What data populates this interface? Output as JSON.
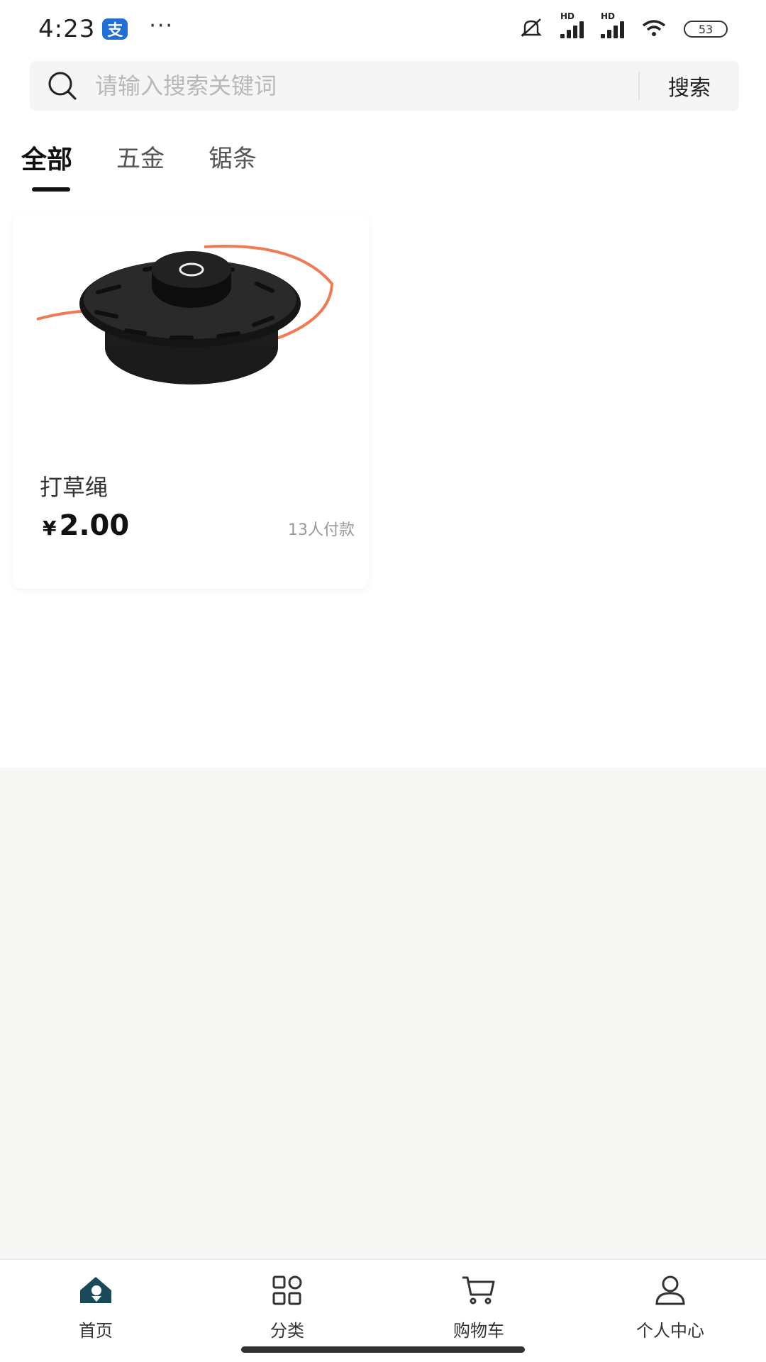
{
  "status_bar": {
    "time": "4:23",
    "alipay_badge": "支",
    "more": "···",
    "battery": "53",
    "signal_label": "HD"
  },
  "search": {
    "placeholder": "请输入搜索关键词",
    "button_label": "搜索"
  },
  "tabs": [
    {
      "label": "全部",
      "active": true
    },
    {
      "label": "五金",
      "active": false
    },
    {
      "label": "锯条",
      "active": false
    }
  ],
  "products": [
    {
      "name": "打草绳",
      "currency": "¥",
      "price": "2.00",
      "paid_count": "13人付款",
      "image_icon": "trimmer-head-image"
    }
  ],
  "bottom_nav": [
    {
      "label": "首页",
      "icon": "home-icon",
      "active": true
    },
    {
      "label": "分类",
      "icon": "category-grid-icon",
      "active": false
    },
    {
      "label": "购物车",
      "icon": "cart-icon",
      "active": false
    },
    {
      "label": "个人中心",
      "icon": "profile-icon",
      "active": false
    }
  ],
  "colors": {
    "accent": "#1a4a5a",
    "text": "#222222",
    "muted": "#999999",
    "background_grey": "#f7f7f6"
  }
}
